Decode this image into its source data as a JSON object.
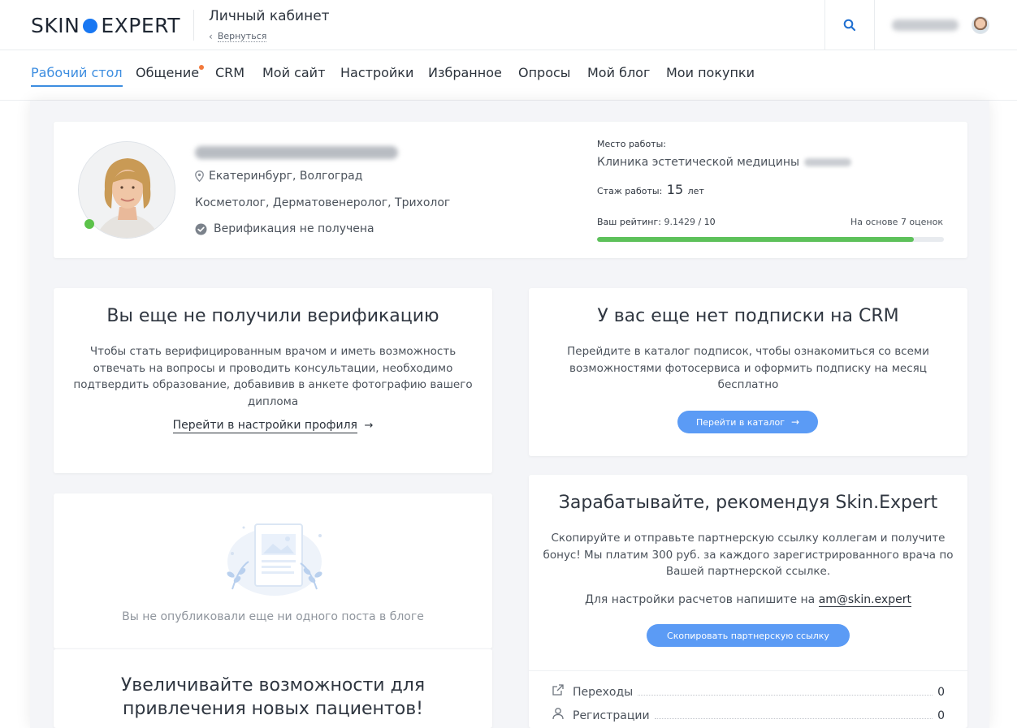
{
  "header": {
    "logo_left": "SKIN",
    "logo_right": "EXPERT",
    "title": "Личный кабинет",
    "back_label": "Вернуться"
  },
  "nav": {
    "items": [
      {
        "label": "Рабочий стол"
      },
      {
        "label": "Общение"
      },
      {
        "label": "CRM"
      },
      {
        "label": "Мой сайт"
      },
      {
        "label": "Настройки"
      },
      {
        "label": "Избранное"
      },
      {
        "label": "Опросы"
      },
      {
        "label": "Мой блог"
      },
      {
        "label": "Мои покупки"
      }
    ]
  },
  "profile": {
    "city": "Екатеринбург, Волгоград",
    "specialties": "Косметолог, Дерматовенеролог, Трихолог",
    "verification": "Верификация не получена",
    "work_label": "Место работы:",
    "clinic": "Клиника эстетической медицины",
    "experience_label": "Стаж работы:",
    "experience_value": "15",
    "experience_unit": "лет",
    "rating_label": "Ваш рейтинг:",
    "rating_value": "9.1429",
    "rating_max": "/ 10",
    "rating_basis": "На основе 7 оценок",
    "rating_fraction": 0.914
  },
  "verification_card": {
    "title": "Вы еще не получили верификацию",
    "text_lines": [
      "Чтобы стать верифицированным врачом и иметь возможность",
      "отвечать на вопросы и проводить консультации, необходимо",
      "подтвердить образование, добавивив в анкете фотографию вашего",
      "диплома"
    ],
    "link": "Перейти в настройки профиля"
  },
  "crm_card": {
    "title": "У вас еще нет подписки на CRM",
    "text_lines": [
      "Перейдите в каталог подписок, чтобы ознакомиться со всеми",
      "возможностями фотосервиса и оформить подписку на месяц",
      "бесплатно"
    ],
    "button": "Перейти в каталог"
  },
  "blog_card": {
    "empty_text": "Вы не опубликовали еще ни одного поста в блоге"
  },
  "promo_card": {
    "title_line1": "Увеличивайте возможности для",
    "title_line2": "привлечения новых пациентов!"
  },
  "partner_card": {
    "title": "Зарабатывайте, рекомендуя Skin.Expert",
    "text_lines": [
      "Скопируйте и отправьте партнерскую ссылку коллегам и получите",
      "бонус! Мы платим 300 руб. за каждого зарегистрированного врача по",
      "Вашей партнерской ссылке."
    ],
    "contact_prefix": "Для настройки расчетов напишите на",
    "contact_email": "am@skin.expert",
    "button": "Скопировать партнерскую ссылку",
    "stats": [
      {
        "label": "Переходы",
        "value": "0"
      },
      {
        "label": "Регистрации",
        "value": "0"
      }
    ]
  }
}
